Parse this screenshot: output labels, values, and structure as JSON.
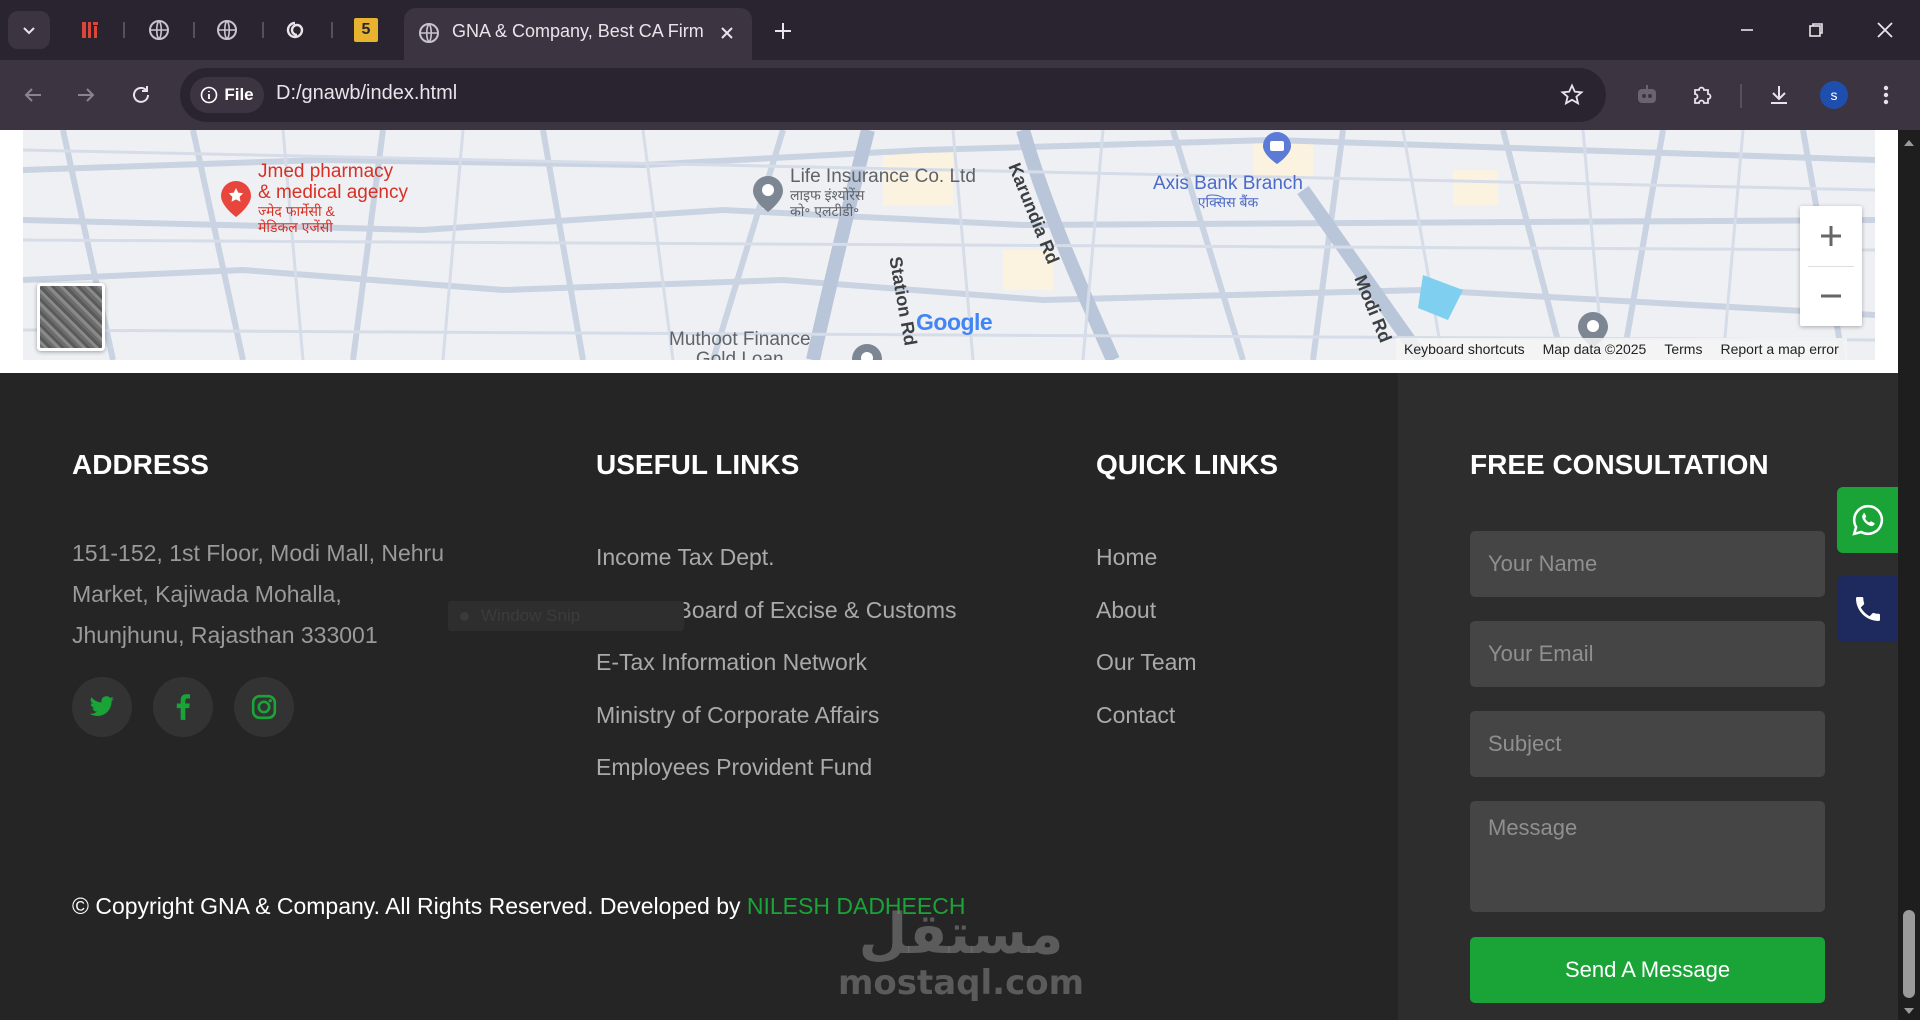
{
  "browser": {
    "active_tab_title": "GNA & Company, Best CA Firm",
    "pinned_tab_badge": "5",
    "url_chip": "File",
    "url": "D:/gnawb/index.html",
    "profile_initial": "s"
  },
  "map": {
    "pois": {
      "pharmacy_line1": "Jmed pharmacy",
      "pharmacy_line2": "& medical agency",
      "pharmacy_hi1": "ज्मेद फार्मेसी &",
      "pharmacy_hi2": "मेडिकल एजेंसी",
      "insurance_line1": "Life Insurance Co. Ltd",
      "insurance_hi1": "लाइफ इंश्योरेंस",
      "insurance_hi2": "को॰ एलटीडी॰",
      "axis_line1": "Axis Bank Branch",
      "axis_hi": "एक्सिस बैंक",
      "muthoot_line1": "Muthoot Finance",
      "muthoot_line2": "Gold Loan"
    },
    "roads": {
      "karundia": "Karundia Rd",
      "station": "Station Rd",
      "modi": "Modi Rd"
    },
    "google": "Google",
    "attribution": {
      "shortcuts": "Keyboard shortcuts",
      "map_data": "Map data ©2025",
      "terms": "Terms",
      "report": "Report a map error"
    }
  },
  "footer": {
    "address": {
      "heading": "ADDRESS",
      "line1": "151-152, 1st Floor, Modi Mall, Nehru",
      "line2": "Market, Kajiwada Mohalla,",
      "line3": "Jhunjhunu, Rajasthan 333001"
    },
    "useful_links": {
      "heading": "USEFUL LINKS",
      "items": [
        "Income Tax Dept.",
        "Central Board of Excise & Customs",
        "E-Tax Information Network",
        "Ministry of Corporate Affairs",
        "Employees Provident Fund"
      ]
    },
    "quick_links": {
      "heading": "QUICK LINKS",
      "items": [
        "Home",
        "About",
        "Our Team",
        "Contact"
      ]
    },
    "consultation": {
      "heading": "FREE CONSULTATION",
      "name_placeholder": "Your Name",
      "email_placeholder": "Your Email",
      "subject_placeholder": "Subject",
      "message_placeholder": "Message",
      "send_label": "Send A Message"
    },
    "copyright": {
      "text": "© Copyright GNA & Company. All Rights Reserved. Developed by ",
      "developer": "NILESH DADHEECH"
    }
  },
  "overlay": {
    "snip_label": "Window Snip",
    "watermark_ar": "مستقل",
    "watermark_en": "mostaql.com"
  },
  "colors": {
    "accent_green": "#1aa438",
    "footer_bg": "#252525",
    "consult_bg": "#2d2d2d",
    "whatsapp_green": "#1aa438",
    "phone_navy": "#1e2a5e"
  }
}
